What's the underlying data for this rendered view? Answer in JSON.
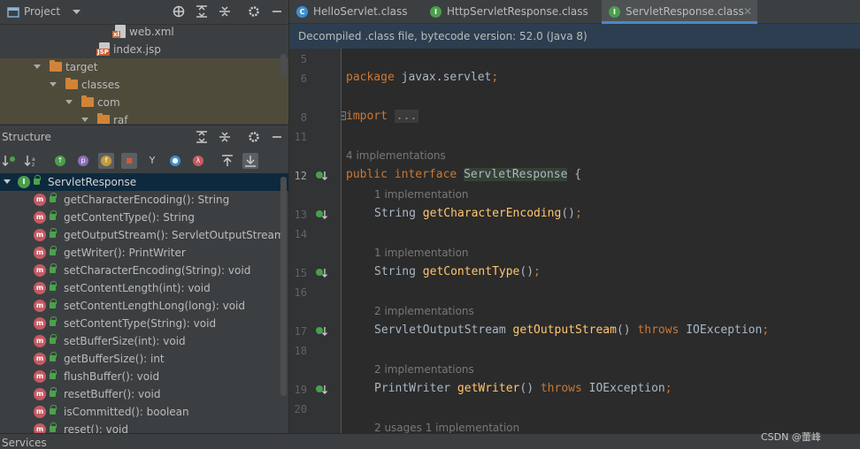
{
  "project": {
    "title": "Project",
    "tree": [
      {
        "label": "web.xml",
        "kind": "file-xml"
      },
      {
        "label": "index.jsp",
        "kind": "file-jsp"
      },
      {
        "label": "target",
        "kind": "folder"
      },
      {
        "label": "classes",
        "kind": "folder"
      },
      {
        "label": "com",
        "kind": "folder"
      },
      {
        "label": "raf",
        "kind": "folder"
      }
    ]
  },
  "structure": {
    "title": "Structure",
    "root": "ServletResponse",
    "members": [
      "getCharacterEncoding(): String",
      "getContentType(): String",
      "getOutputStream(): ServletOutputStream",
      "getWriter(): PrintWriter",
      "setCharacterEncoding(String): void",
      "setContentLength(int): void",
      "setContentLengthLong(long): void",
      "setContentType(String): void",
      "setBufferSize(int): void",
      "getBufferSize(): int",
      "flushBuffer(): void",
      "resetBuffer(): void",
      "isCommitted(): boolean",
      "reset(): void"
    ]
  },
  "bottom": {
    "services": "Services"
  },
  "tabs": [
    {
      "label": "HelloServlet.class",
      "icon": "C",
      "color": "#3d8fd1"
    },
    {
      "label": "HttpServletResponse.class",
      "icon": "I",
      "color": "#4b9e4b"
    },
    {
      "label": "ServletResponse.class",
      "icon": "I",
      "color": "#4b9e4b",
      "active": true
    }
  ],
  "banner": "Decompiled .class file, bytecode version: 52.0 (Java 8)",
  "code": {
    "line_numbers": [
      "5",
      "6",
      "8",
      "11",
      "12",
      "13",
      "14",
      "15",
      "16",
      "17",
      "18",
      "19",
      "20"
    ],
    "package_kw": "package",
    "package_name": "javax.servlet",
    "import_kw": "import",
    "import_fold": "...",
    "hint_iface": "4 implementations",
    "iface_kw": "public interface",
    "iface_name": "ServletResponse",
    "brace": "{",
    "hint1": "1 implementation",
    "m1_type": "String",
    "m1_name": "getCharacterEncoding",
    "hint2": "1 implementation",
    "m2_type": "String",
    "m2_name": "getContentType",
    "hint3": "2 implementations",
    "m3_type": "ServletOutputStream",
    "m3_name": "getOutputStream",
    "hint4": "2 implementations",
    "m4_type": "PrintWriter",
    "m4_name": "getWriter",
    "throws_kw": "throws",
    "exception": "IOException",
    "hint5": "2 usages   1 implementation"
  },
  "watermark": "CSDN @蕾峰"
}
